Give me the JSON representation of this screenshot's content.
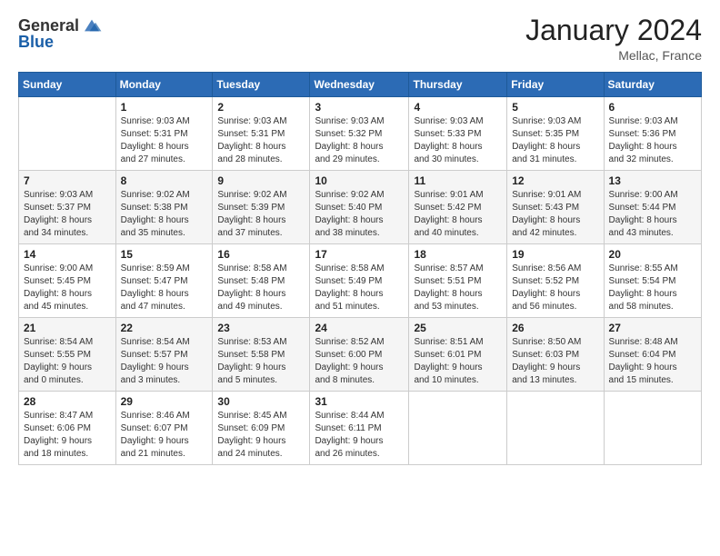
{
  "logo": {
    "general": "General",
    "blue": "Blue"
  },
  "header": {
    "month": "January 2024",
    "location": "Mellac, France"
  },
  "weekdays": [
    "Sunday",
    "Monday",
    "Tuesday",
    "Wednesday",
    "Thursday",
    "Friday",
    "Saturday"
  ],
  "weeks": [
    [
      {
        "day": "",
        "info": ""
      },
      {
        "day": "1",
        "info": "Sunrise: 9:03 AM\nSunset: 5:31 PM\nDaylight: 8 hours\nand 27 minutes."
      },
      {
        "day": "2",
        "info": "Sunrise: 9:03 AM\nSunset: 5:31 PM\nDaylight: 8 hours\nand 28 minutes."
      },
      {
        "day": "3",
        "info": "Sunrise: 9:03 AM\nSunset: 5:32 PM\nDaylight: 8 hours\nand 29 minutes."
      },
      {
        "day": "4",
        "info": "Sunrise: 9:03 AM\nSunset: 5:33 PM\nDaylight: 8 hours\nand 30 minutes."
      },
      {
        "day": "5",
        "info": "Sunrise: 9:03 AM\nSunset: 5:35 PM\nDaylight: 8 hours\nand 31 minutes."
      },
      {
        "day": "6",
        "info": "Sunrise: 9:03 AM\nSunset: 5:36 PM\nDaylight: 8 hours\nand 32 minutes."
      }
    ],
    [
      {
        "day": "7",
        "info": "Sunrise: 9:03 AM\nSunset: 5:37 PM\nDaylight: 8 hours\nand 34 minutes."
      },
      {
        "day": "8",
        "info": "Sunrise: 9:02 AM\nSunset: 5:38 PM\nDaylight: 8 hours\nand 35 minutes."
      },
      {
        "day": "9",
        "info": "Sunrise: 9:02 AM\nSunset: 5:39 PM\nDaylight: 8 hours\nand 37 minutes."
      },
      {
        "day": "10",
        "info": "Sunrise: 9:02 AM\nSunset: 5:40 PM\nDaylight: 8 hours\nand 38 minutes."
      },
      {
        "day": "11",
        "info": "Sunrise: 9:01 AM\nSunset: 5:42 PM\nDaylight: 8 hours\nand 40 minutes."
      },
      {
        "day": "12",
        "info": "Sunrise: 9:01 AM\nSunset: 5:43 PM\nDaylight: 8 hours\nand 42 minutes."
      },
      {
        "day": "13",
        "info": "Sunrise: 9:00 AM\nSunset: 5:44 PM\nDaylight: 8 hours\nand 43 minutes."
      }
    ],
    [
      {
        "day": "14",
        "info": "Sunrise: 9:00 AM\nSunset: 5:45 PM\nDaylight: 8 hours\nand 45 minutes."
      },
      {
        "day": "15",
        "info": "Sunrise: 8:59 AM\nSunset: 5:47 PM\nDaylight: 8 hours\nand 47 minutes."
      },
      {
        "day": "16",
        "info": "Sunrise: 8:58 AM\nSunset: 5:48 PM\nDaylight: 8 hours\nand 49 minutes."
      },
      {
        "day": "17",
        "info": "Sunrise: 8:58 AM\nSunset: 5:49 PM\nDaylight: 8 hours\nand 51 minutes."
      },
      {
        "day": "18",
        "info": "Sunrise: 8:57 AM\nSunset: 5:51 PM\nDaylight: 8 hours\nand 53 minutes."
      },
      {
        "day": "19",
        "info": "Sunrise: 8:56 AM\nSunset: 5:52 PM\nDaylight: 8 hours\nand 56 minutes."
      },
      {
        "day": "20",
        "info": "Sunrise: 8:55 AM\nSunset: 5:54 PM\nDaylight: 8 hours\nand 58 minutes."
      }
    ],
    [
      {
        "day": "21",
        "info": "Sunrise: 8:54 AM\nSunset: 5:55 PM\nDaylight: 9 hours\nand 0 minutes."
      },
      {
        "day": "22",
        "info": "Sunrise: 8:54 AM\nSunset: 5:57 PM\nDaylight: 9 hours\nand 3 minutes."
      },
      {
        "day": "23",
        "info": "Sunrise: 8:53 AM\nSunset: 5:58 PM\nDaylight: 9 hours\nand 5 minutes."
      },
      {
        "day": "24",
        "info": "Sunrise: 8:52 AM\nSunset: 6:00 PM\nDaylight: 9 hours\nand 8 minutes."
      },
      {
        "day": "25",
        "info": "Sunrise: 8:51 AM\nSunset: 6:01 PM\nDaylight: 9 hours\nand 10 minutes."
      },
      {
        "day": "26",
        "info": "Sunrise: 8:50 AM\nSunset: 6:03 PM\nDaylight: 9 hours\nand 13 minutes."
      },
      {
        "day": "27",
        "info": "Sunrise: 8:48 AM\nSunset: 6:04 PM\nDaylight: 9 hours\nand 15 minutes."
      }
    ],
    [
      {
        "day": "28",
        "info": "Sunrise: 8:47 AM\nSunset: 6:06 PM\nDaylight: 9 hours\nand 18 minutes."
      },
      {
        "day": "29",
        "info": "Sunrise: 8:46 AM\nSunset: 6:07 PM\nDaylight: 9 hours\nand 21 minutes."
      },
      {
        "day": "30",
        "info": "Sunrise: 8:45 AM\nSunset: 6:09 PM\nDaylight: 9 hours\nand 24 minutes."
      },
      {
        "day": "31",
        "info": "Sunrise: 8:44 AM\nSunset: 6:11 PM\nDaylight: 9 hours\nand 26 minutes."
      },
      {
        "day": "",
        "info": ""
      },
      {
        "day": "",
        "info": ""
      },
      {
        "day": "",
        "info": ""
      }
    ]
  ]
}
